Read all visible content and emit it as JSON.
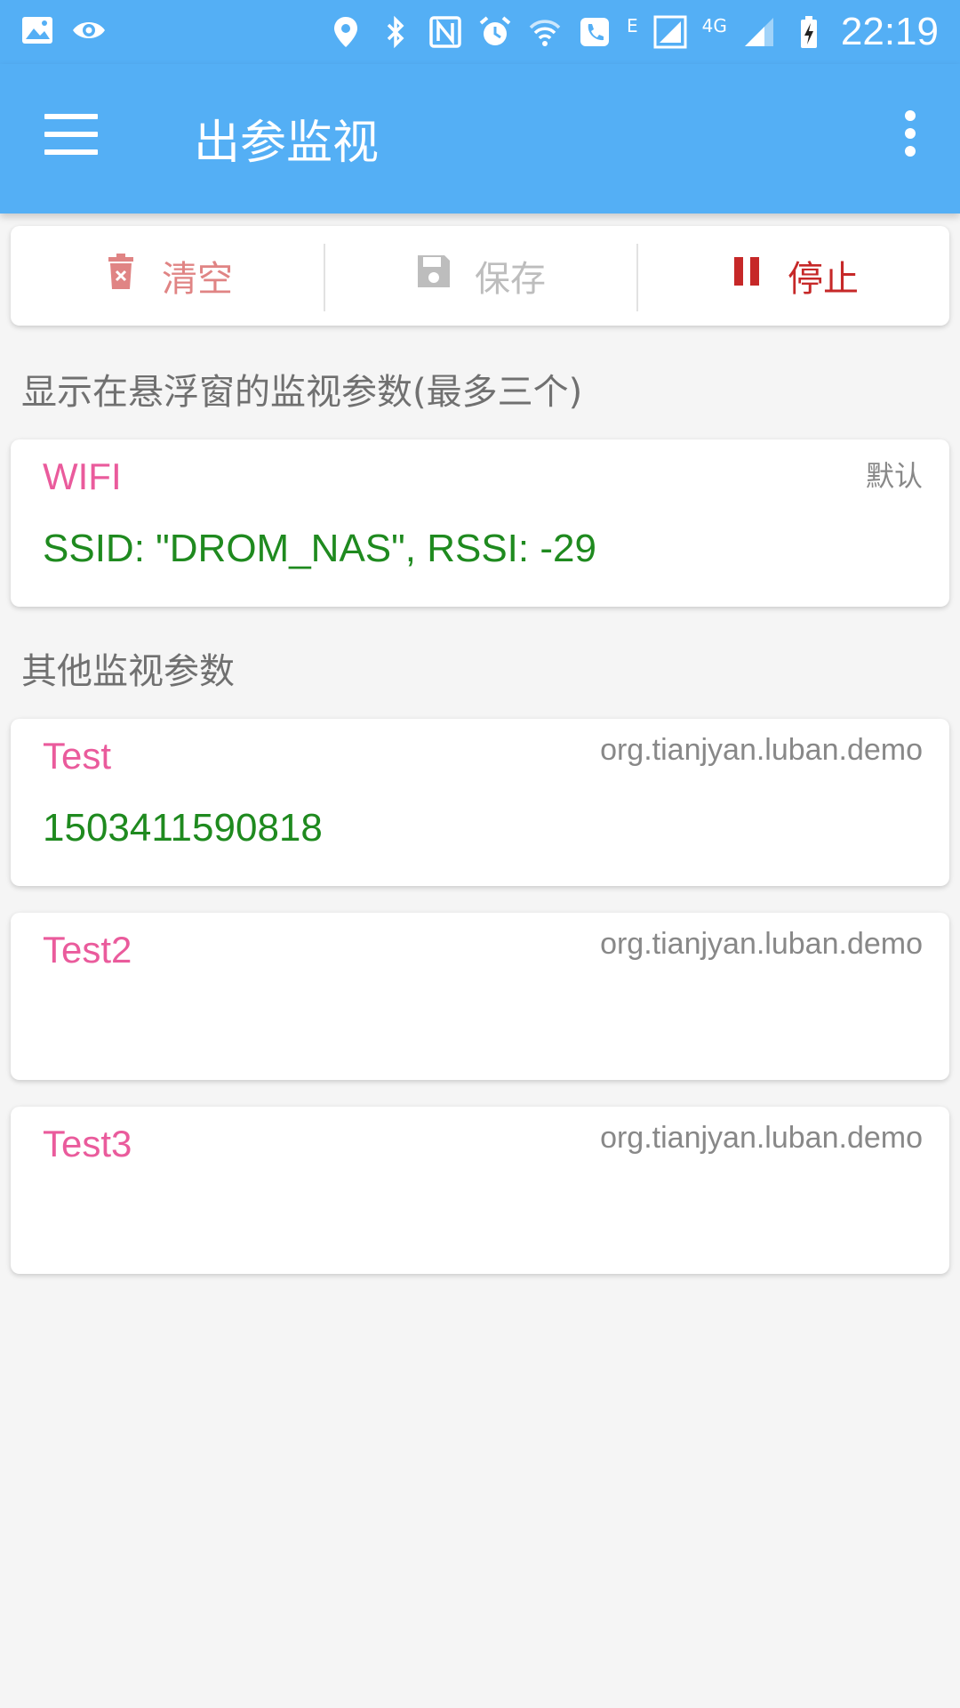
{
  "status_bar": {
    "time": "22:19",
    "network_e": "E",
    "network_4g": "4G",
    "icons": [
      "image-icon",
      "eye-icon",
      "location-icon",
      "bluetooth-icon",
      "nfc-icon",
      "alarm-icon",
      "wifi-icon",
      "call-icon",
      "signal-icon",
      "signal-icon-2",
      "battery-charging-icon"
    ]
  },
  "toolbar": {
    "title": "出参监视",
    "menu_icon": "hamburger-menu-icon",
    "overflow_icon": "more-vert-icon",
    "background": "#54aff5"
  },
  "actions": {
    "clear_label": "清空",
    "save_label": "保存",
    "stop_label": "停止",
    "clear_icon": "trash-icon",
    "save_icon": "floppy-disk-icon",
    "stop_icon": "pause-icon"
  },
  "sections": {
    "floating_label": "显示在悬浮窗的监视参数(最多三个)",
    "other_label": "其他监视参数"
  },
  "floating_params": [
    {
      "name": "WIFI",
      "tag": "默认",
      "value": "SSID: \"DROM_NAS\", RSSI: -29"
    }
  ],
  "other_params": [
    {
      "name": "Test",
      "tag": "org.tianjyan.luban.demo",
      "value": "1503411590818"
    },
    {
      "name": "Test2",
      "tag": "org.tianjyan.luban.demo",
      "value": ""
    },
    {
      "name": "Test3",
      "tag": "org.tianjyan.luban.demo",
      "value": ""
    }
  ],
  "colors": {
    "accent": "#54aff5",
    "param_name": "#ea5b9c",
    "param_value": "#1f8a1f",
    "stop": "#c62828",
    "clear": "#e08484"
  }
}
